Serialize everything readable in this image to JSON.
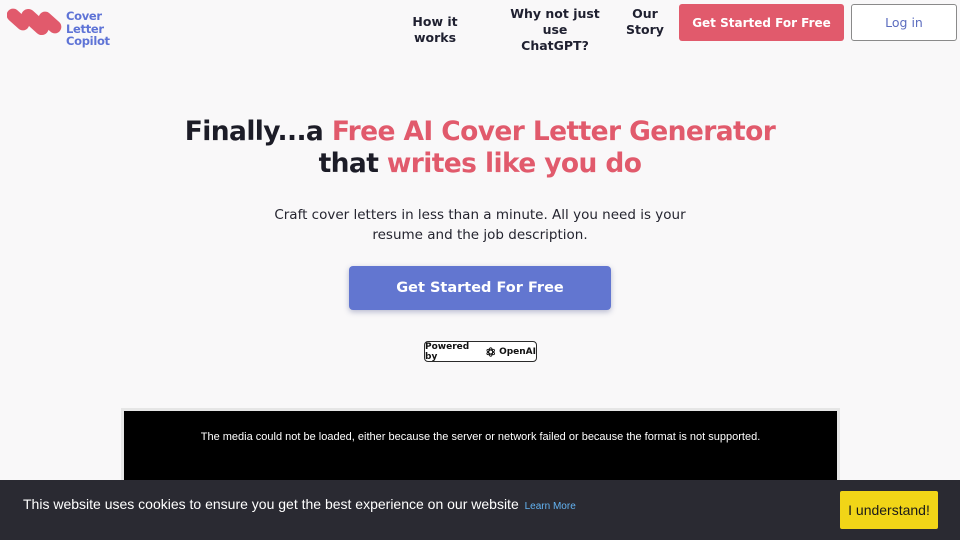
{
  "header": {
    "logo": {
      "line1": "Cover Letter",
      "line2": "Copilot"
    },
    "nav": {
      "how_it_works": "How it works",
      "why_line1": "Why not just use",
      "why_line2": "ChatGPT?",
      "story_line1": "Our",
      "story_line2": "Story"
    },
    "cta_label": "Get Started For Free",
    "login_label": "Log in"
  },
  "hero": {
    "title_part1": "Finally...a ",
    "title_accent1": "Free AI Cover Letter Generator",
    "title_part2": "that ",
    "title_accent2": "writes like you do",
    "subtitle": "Craft cover letters in less than a minute. All you need is your resume and the job description.",
    "cta_label": "Get Started For Free",
    "powered_by_prefix": "Powered by",
    "powered_by_brand": "OpenAI"
  },
  "video": {
    "error_message": "The media could not be loaded, either because the server or network failed or because the format is not supported."
  },
  "cookie": {
    "message": "This website uses cookies to ensure you get the best experience on our website",
    "learn_more": "Learn More",
    "accept_label": "I understand!"
  },
  "colors": {
    "accent_red": "#e15a6c",
    "accent_blue": "#6276d0",
    "cookie_button": "#f1d517",
    "cookie_bg": "#2a2a32"
  }
}
